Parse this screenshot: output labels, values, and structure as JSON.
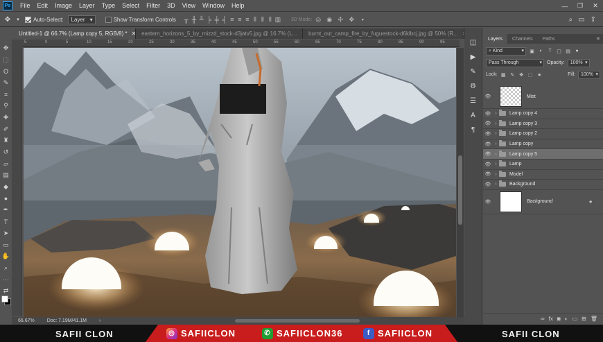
{
  "app": {
    "logo": "Ps",
    "menus": [
      "File",
      "Edit",
      "Image",
      "Layer",
      "Type",
      "Select",
      "Filter",
      "3D",
      "View",
      "Window",
      "Help"
    ]
  },
  "options": {
    "auto_select_label": "Auto-Select:",
    "auto_select_target": "Layer",
    "transform_label": "Show Transform Controls",
    "mode_3d": "3D Mode:"
  },
  "tabs": [
    {
      "title": "Untitled-1 @ 66.7% (Lamp copy 5, RGB/8) *"
    },
    {
      "title": "eastern_horizons_5_by_mizzd_stock-d3jatv5.jpg @ 16.7% (L..."
    },
    {
      "title": "burnt_out_camp_fire_by_fuguestock-d6klbcj.jpg @ 50% (R..."
    }
  ],
  "ruler_top": [
    "5",
    "0",
    "5",
    "10",
    "15",
    "20",
    "25",
    "30",
    "35",
    "40",
    "45",
    "50",
    "55",
    "60",
    "65",
    "70",
    "75",
    "80",
    "85",
    "90",
    "95"
  ],
  "status": {
    "zoom": "66.67%",
    "doc": "Doc: 7.19M/41.1M"
  },
  "panel": {
    "tabs": [
      "Layers",
      "Channels",
      "Paths"
    ],
    "filter_kind": "Kind",
    "blend_mode": "Pass Through",
    "opacity_label": "Opacity:",
    "opacity_value": "100%",
    "lock_label": "Lock:",
    "fill_label": "Fill:",
    "fill_value": "100%"
  },
  "layers": [
    {
      "name": "Mist",
      "type": "pixel"
    },
    {
      "name": "Lamp copy 4",
      "type": "group"
    },
    {
      "name": "Lamp copy 3",
      "type": "group"
    },
    {
      "name": "Lamp copy 2",
      "type": "group"
    },
    {
      "name": "Lamp copy",
      "type": "group"
    },
    {
      "name": "Lamp copy 5",
      "type": "group",
      "selected": true
    },
    {
      "name": "Lamp",
      "type": "group"
    },
    {
      "name": "Model",
      "type": "group"
    },
    {
      "name": "Background",
      "type": "group"
    },
    {
      "name": "Background",
      "type": "background"
    }
  ],
  "banner": {
    "left": "SAFII CLON",
    "right": "SAFII CLON",
    "instagram": "SAFIICLON",
    "whatsapp": "SAFIICLON36",
    "facebook": "SAFIICLON"
  }
}
